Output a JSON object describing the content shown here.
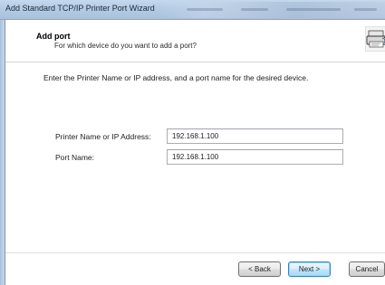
{
  "window": {
    "title": "Add Standard TCP/IP Printer Port Wizard"
  },
  "header": {
    "title": "Add port",
    "subtitle": "For which device do you want to add a port?",
    "icon": "printer-port-icon"
  },
  "body": {
    "instruction": "Enter the Printer Name or IP address, and a port name for the desired device.",
    "fields": [
      {
        "label": "Printer Name or IP Address:",
        "value": "192.168.1.100"
      },
      {
        "label": "Port Name:",
        "value": "192.168.1.100"
      }
    ]
  },
  "buttons": {
    "back": "< Back",
    "next": "Next >",
    "cancel": "Cancel"
  }
}
